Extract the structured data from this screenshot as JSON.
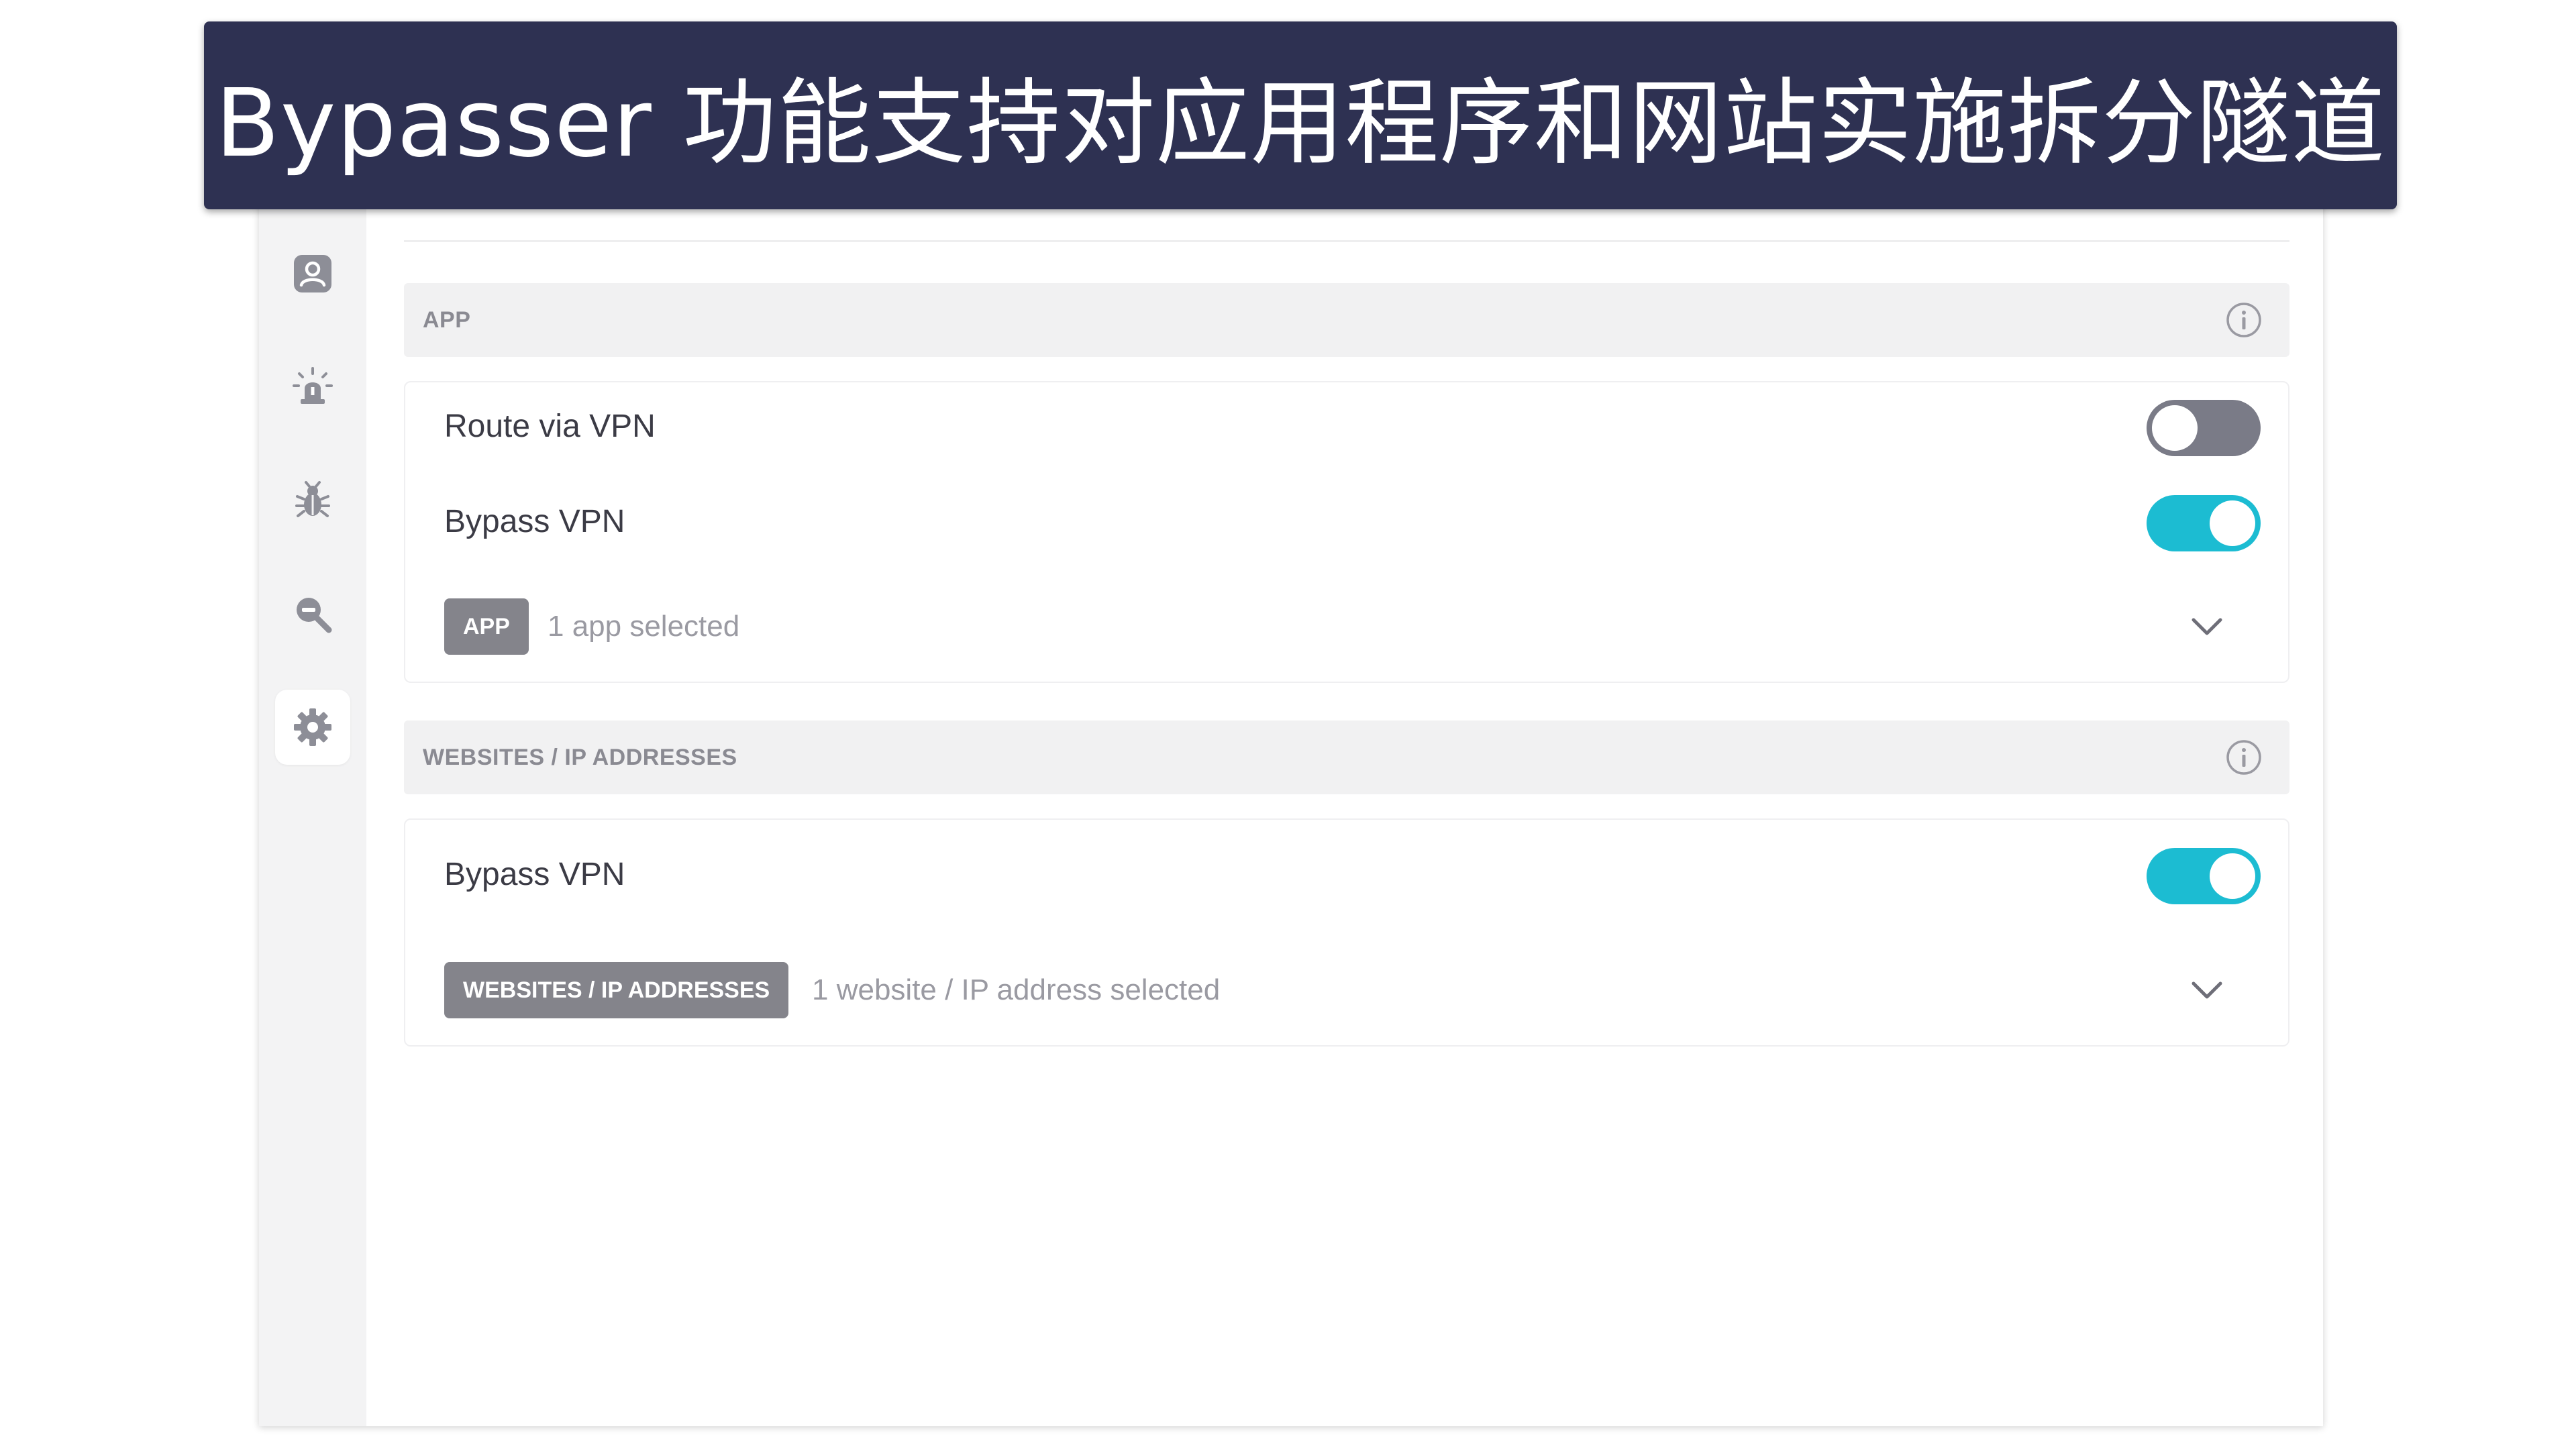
{
  "banner": {
    "title": "Bypasser 功能支持对应用程序和网站实施拆分隧道"
  },
  "sidebar": {
    "icons": [
      "user-icon",
      "alert-icon",
      "bug-icon",
      "search-icon",
      "gear-icon"
    ],
    "active": "gear-icon"
  },
  "app_section": {
    "header": "APP",
    "route_via_vpn_label": "Route via VPN",
    "route_via_vpn_on": false,
    "bypass_vpn_label": "Bypass VPN",
    "bypass_vpn_on": true,
    "tag": "APP",
    "selected_text": "1 app selected"
  },
  "websites_section": {
    "header": "WEBSITES / IP ADDRESSES",
    "bypass_vpn_label": "Bypass VPN",
    "bypass_vpn_on": true,
    "tag": "WEBSITES / IP ADDRESSES",
    "selected_text": "1 website / IP address selected"
  },
  "colors": {
    "banner_bg": "#2e3152",
    "toggle_on": "#1cbcd2",
    "toggle_off": "#7a7b87",
    "tag_bg": "#84848b"
  }
}
